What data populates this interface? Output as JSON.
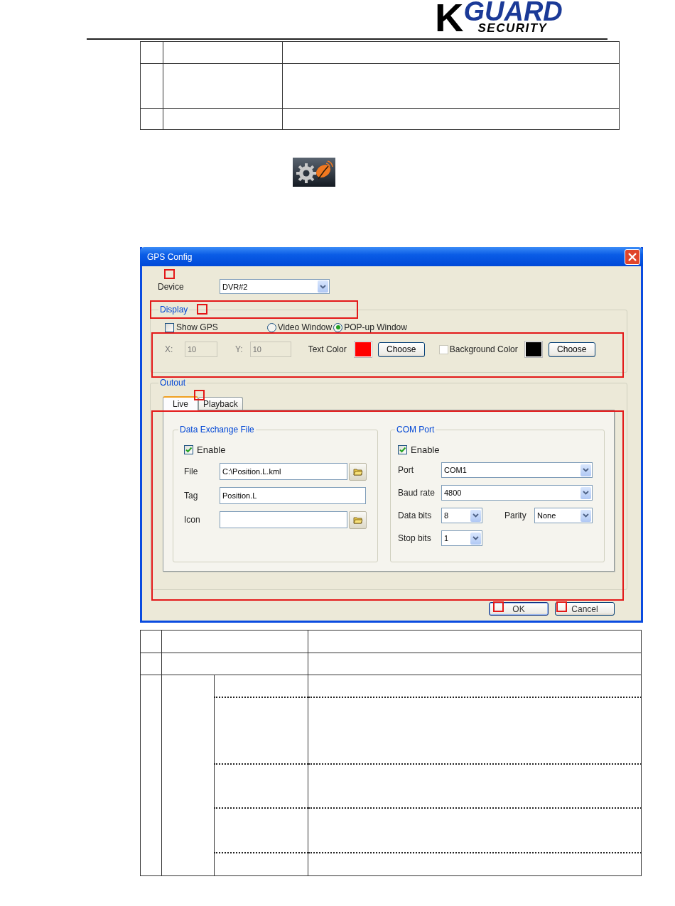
{
  "header": {
    "logo": {
      "mark": "K",
      "name": "GUARD",
      "tagline": "SECURITY"
    }
  },
  "dialog": {
    "title": "GPS Config",
    "device": {
      "label": "Device",
      "value": "DVR#2"
    },
    "display": {
      "title": "Display",
      "show_gps": {
        "label": "Show GPS",
        "checked": false
      },
      "window_options": [
        {
          "label": "Video Window",
          "selected": false
        },
        {
          "label": "POP-up Window",
          "selected": true
        }
      ],
      "x": {
        "label": "X:",
        "value": "10",
        "disabled": true
      },
      "y": {
        "label": "Y:",
        "value": "10",
        "disabled": true
      },
      "text_color": {
        "label": "Text Color",
        "color": "#ff0000",
        "button": "Choose"
      },
      "background_color": {
        "label": "Background Color",
        "checked": false,
        "color": "#000000",
        "button": "Choose"
      }
    },
    "output": {
      "title": "Outout",
      "tabs": [
        {
          "label": "Live",
          "selected": true
        },
        {
          "label": "Playback",
          "selected": false
        }
      ],
      "data_exchange_file": {
        "title": "Data Exchange File",
        "enable": {
          "label": "Enable",
          "checked": true
        },
        "fields": [
          {
            "label": "File",
            "value": "C:\\Position.L.kml",
            "browse": true
          },
          {
            "label": "Tag",
            "value": "Position.L",
            "browse": false
          },
          {
            "label": "Icon",
            "browse": true
          }
        ]
      },
      "com_port": {
        "title": "COM Port",
        "enable": {
          "label": "Enable",
          "checked": true
        },
        "port": {
          "label": "Port",
          "value": "COM1"
        },
        "baud_rate": {
          "label": "Baud rate",
          "value": "4800"
        },
        "data_bits": {
          "label": "Data bits",
          "value": "8"
        },
        "parity": {
          "label": "Parity",
          "value": "None"
        },
        "stop_bits": {
          "label": "Stop bits",
          "value": "1"
        }
      }
    },
    "buttons": [
      {
        "label": "OK",
        "default": true
      },
      {
        "label": "Cancel",
        "default": false
      }
    ]
  }
}
